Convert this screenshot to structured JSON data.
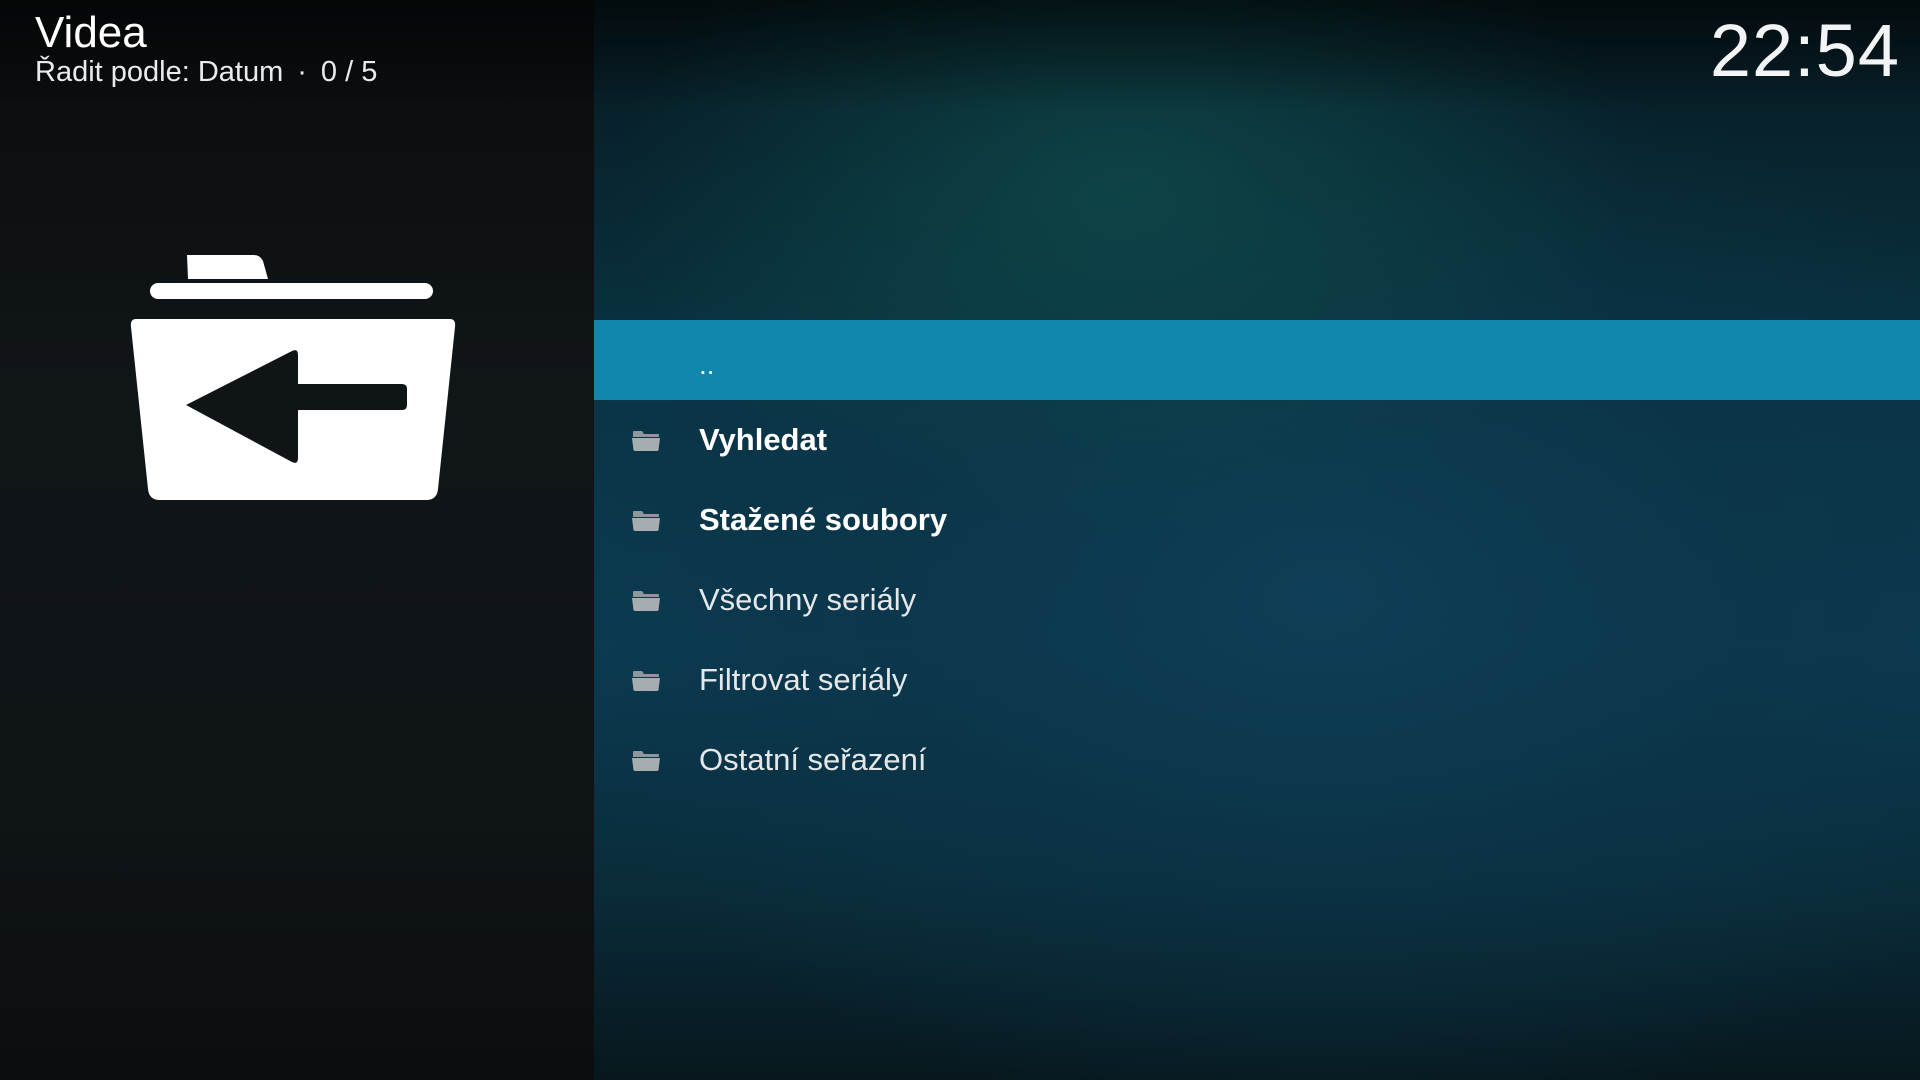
{
  "header": {
    "title": "Videa",
    "sort_label": "Řadit podle: Datum",
    "separator": "·",
    "position": "0 / 5"
  },
  "clock": {
    "time": "22:54"
  },
  "info_panel": {
    "icon": "folder-back-icon"
  },
  "list": {
    "items": [
      {
        "label": "..",
        "icon": "",
        "bold": false,
        "focused": true
      },
      {
        "label": "Vyhledat",
        "icon": "folder-icon",
        "bold": true,
        "focused": false
      },
      {
        "label": "Stažené soubory",
        "icon": "folder-icon",
        "bold": true,
        "focused": false
      },
      {
        "label": "Všechny seriály",
        "icon": "folder-icon",
        "bold": false,
        "focused": false
      },
      {
        "label": "Filtrovat seriály",
        "icon": "folder-icon",
        "bold": false,
        "focused": false
      },
      {
        "label": "Ostatní seřazení",
        "icon": "folder-icon",
        "bold": false,
        "focused": false
      }
    ]
  },
  "colors": {
    "focus_highlight": "#1187ab",
    "left_panel": "#101518",
    "background_teal": "#0b3b52"
  }
}
